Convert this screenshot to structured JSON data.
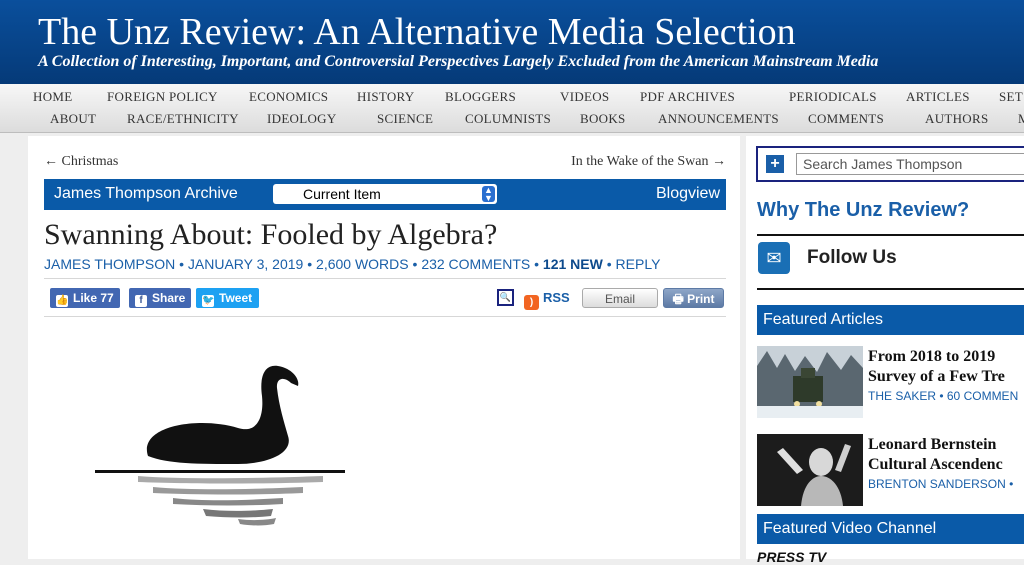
{
  "site": {
    "title": "The Unz Review: An Alternative Media Selection",
    "tagline": "A Collection of Interesting, Important, and Controversial Perspectives Largely Excluded from the American Mainstream Media"
  },
  "nav": {
    "row1": [
      "HOME",
      "FOREIGN POLICY",
      "ECONOMICS",
      "HISTORY",
      "BLOGGERS",
      "VIDEOS",
      "PDF ARCHIVES",
      "PERIODICALS",
      "ARTICLES",
      "SET"
    ],
    "row2": [
      "ABOUT",
      "RACE/ETHNICITY",
      "IDEOLOGY",
      "SCIENCE",
      "COLUMNISTS",
      "BOOKS",
      "ANNOUNCEMENTS",
      "COMMENTS",
      "AUTHORS",
      "M"
    ]
  },
  "post_nav": {
    "prev": "← Christmas",
    "next": "In the Wake of the Swan →"
  },
  "archive": {
    "title": "James Thompson Archive",
    "select_value": "Current Item",
    "blogview": "Blogview"
  },
  "post": {
    "title": "Swanning About: Fooled by Algebra?",
    "author": "JAMES THOMPSON",
    "date": "JANUARY 3, 2019",
    "words": "2,600 WORDS",
    "comments": "232 COMMENTS",
    "new": "121 NEW",
    "reply": "REPLY",
    "separator": "•"
  },
  "share": {
    "like": "Like",
    "like_count": "77",
    "share": "Share",
    "tweet": "Tweet",
    "rss": "RSS",
    "email": "Email",
    "print": "Print"
  },
  "sidebar": {
    "search_placeholder": "Search James Thompson",
    "why": "Why The Unz Review?",
    "follow": "Follow Us",
    "featured_articles": "Featured Articles",
    "articles": [
      {
        "title1": "From 2018 to 2019",
        "title2": "Survey of a Few Tre",
        "meta": "THE SAKER • 60 COMMEN"
      },
      {
        "title1": "Leonard Bernstein",
        "title2": "Cultural Ascendenc",
        "meta": "BRENTON SANDERSON •"
      }
    ],
    "featured_video": "Featured Video Channel",
    "press": "PRESS TV"
  },
  "colors": {
    "brand": "#0a4f9c",
    "link": "#1a5fa8",
    "rss": "#f26522"
  }
}
